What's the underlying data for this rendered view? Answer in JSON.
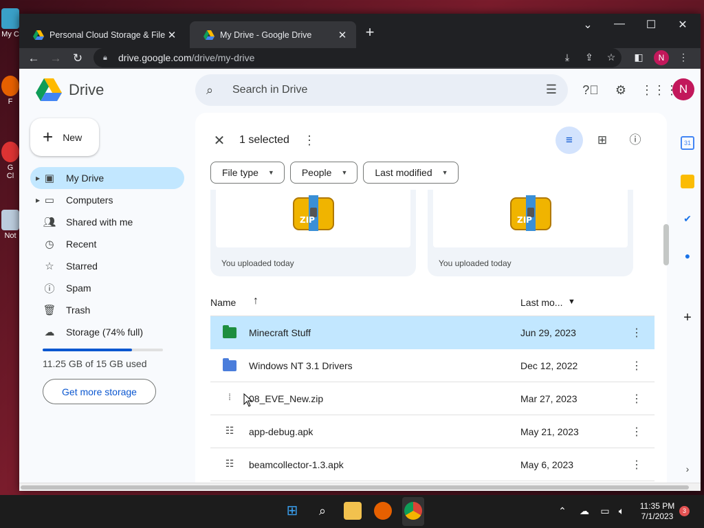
{
  "browser": {
    "tabs": [
      {
        "title": "Personal Cloud Storage & File Sh",
        "active": false
      },
      {
        "title": "My Drive - Google Drive",
        "active": true
      }
    ],
    "url_host": "drive.google.com",
    "url_path": "/drive/my-drive",
    "profile_initial": "N"
  },
  "drive": {
    "logo_text": "Drive",
    "search_placeholder": "Search in Drive",
    "avatar_initial": "N",
    "new_label": "New",
    "nav": [
      {
        "label": "My Drive",
        "icon": "my-drive-icon",
        "active": true,
        "caret": true
      },
      {
        "label": "Computers",
        "icon": "computer-icon",
        "active": false,
        "caret": true
      },
      {
        "label": "Shared with me",
        "icon": "people-icon",
        "active": false,
        "caret": false
      },
      {
        "label": "Recent",
        "icon": "clock-icon",
        "active": false,
        "caret": false
      },
      {
        "label": "Starred",
        "icon": "star-icon",
        "active": false,
        "caret": false
      },
      {
        "label": "Spam",
        "icon": "spam-icon",
        "active": false,
        "caret": false
      },
      {
        "label": "Trash",
        "icon": "trash-icon",
        "active": false,
        "caret": false
      },
      {
        "label": "Storage (74% full)",
        "icon": "cloud-icon",
        "active": false,
        "caret": false
      }
    ],
    "storage": {
      "used_text": "11.25 GB of 15 GB used",
      "fraction": 0.74,
      "button": "Get more storage"
    },
    "selection": {
      "count_text": "1 selected"
    },
    "filters": [
      "File type",
      "People",
      "Last modified"
    ],
    "suggested": [
      {
        "caption": "You uploaded today",
        "icon": "zip-archive-icon"
      },
      {
        "caption": "You uploaded today",
        "icon": "zip-archive-icon"
      }
    ],
    "list": {
      "col_name": "Name",
      "col_modified": "Last mo...",
      "rows": [
        {
          "name": "Minecraft Stuff",
          "date": "Jun 29, 2023",
          "type": "folder",
          "color": "#1e8e3e",
          "selected": true
        },
        {
          "name": "Windows NT 3.1 Drivers",
          "date": "Dec 12, 2022",
          "type": "folder",
          "color": "#4a7ddb",
          "selected": false
        },
        {
          "name": "08_EVE_New.zip",
          "date": "Mar 27, 2023",
          "type": "zip",
          "selected": false
        },
        {
          "name": "app-debug.apk",
          "date": "May 21, 2023",
          "type": "apk",
          "selected": false
        },
        {
          "name": "beamcollector-1.3.apk",
          "date": "May 6, 2023",
          "type": "apk",
          "selected": false
        }
      ]
    }
  },
  "taskbar": {
    "time": "11:35 PM",
    "date": "7/1/2023",
    "notifications": "3"
  },
  "desktop": {
    "icon_labels": [
      "My C",
      "F",
      "G\nCl",
      "Not"
    ]
  },
  "colors": {
    "accent": "#0b57d0",
    "selected_bg": "#c2e7ff",
    "browser_dark": "#202124"
  }
}
